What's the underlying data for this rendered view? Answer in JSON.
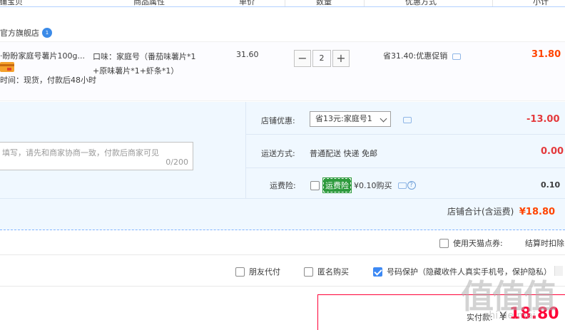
{
  "table_header": {
    "columns": [
      "店铺宝贝",
      "商品属性",
      "单价",
      "数量",
      "优惠方式",
      "小计"
    ]
  },
  "shop": {
    "name": "官方旗舰店",
    "badge": "1"
  },
  "item": {
    "title": "盼盼家庭号薯片100g...",
    "title_prefix": "·",
    "delivery": "时间：现货，付款后48小时",
    "attr_line1": "口味：家庭号（番茄味薯片*1",
    "attr_line2": "+原味薯片*1+虾条*1）",
    "price": "31.60",
    "qty_minus": "−",
    "qty_value": "2",
    "qty_plus": "+",
    "promo": "省31.40:优惠促销",
    "subtotal": "31.80"
  },
  "note": {
    "placeholder": "填写，请先和商家协商一致，付款后商家可见",
    "counter": "0/200"
  },
  "shop_discount": {
    "label": "店铺优惠:",
    "selected": "省13元:家庭号1",
    "value": "-13.00"
  },
  "shipping": {
    "label": "运送方式:",
    "method": "普通配送 快递 免邮",
    "value": "0.00"
  },
  "insurance": {
    "label": "运费险:",
    "tag": "运费险",
    "text": "¥0.10购买",
    "help": "?",
    "value": "0.10"
  },
  "shop_total": {
    "label": "店铺合计(含运费)",
    "value": "¥18.80"
  },
  "coupon": {
    "label": "使用天猫点券:",
    "settle_text": "结算时扣除"
  },
  "options": [
    {
      "label": "朋友代付",
      "checked": false
    },
    {
      "label": "匿名购买",
      "checked": false
    },
    {
      "label": "号码保护（隐藏收件人真实手机号，保护隐私）",
      "checked": true
    }
  ],
  "payment": {
    "label": "实付款:",
    "currency": "¥",
    "amount": "18.80"
  },
  "watermark": {
    "main": "值值值",
    "sub": "zhi.de.mai"
  },
  "colors": {
    "price_accent": "#ff4400",
    "total_red": "#ff0036",
    "discount_red": "#e4393c",
    "panel_bg": "#f0f8ff",
    "link_blue": "#3d89f4",
    "insurance_green": "#2d9a3c"
  },
  "icons": [
    "shop-verified-badge-icon",
    "card-icon",
    "chat-icon",
    "chevron-down-icon",
    "help-icon",
    "checkbox-icon"
  ]
}
